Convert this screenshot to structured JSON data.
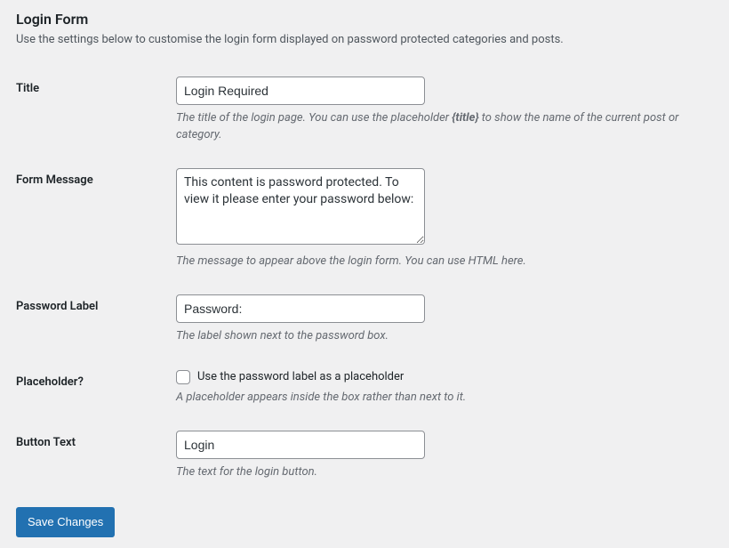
{
  "header": {
    "title": "Login Form",
    "intro": "Use the settings below to customise the login form displayed on password protected categories and posts."
  },
  "fields": {
    "title": {
      "label": "Title",
      "value": "Login Required",
      "desc_before": "The title of the login page. You can use the placeholder ",
      "desc_bold": "{title}",
      "desc_after": " to show the name of the current post or category."
    },
    "form_message": {
      "label": "Form Message",
      "value": "This content is password protected. To view it please enter your password below:",
      "desc": "The message to appear above the login form. You can use HTML here."
    },
    "password_label": {
      "label": "Password Label",
      "value": "Password:",
      "desc": "The label shown next to the password box."
    },
    "placeholder": {
      "label": "Placeholder?",
      "checkbox_label": "Use the password label as a placeholder",
      "desc": "A placeholder appears inside the box rather than next to it."
    },
    "button_text": {
      "label": "Button Text",
      "value": "Login",
      "desc": "The text for the login button."
    }
  },
  "submit": {
    "label": "Save Changes"
  }
}
